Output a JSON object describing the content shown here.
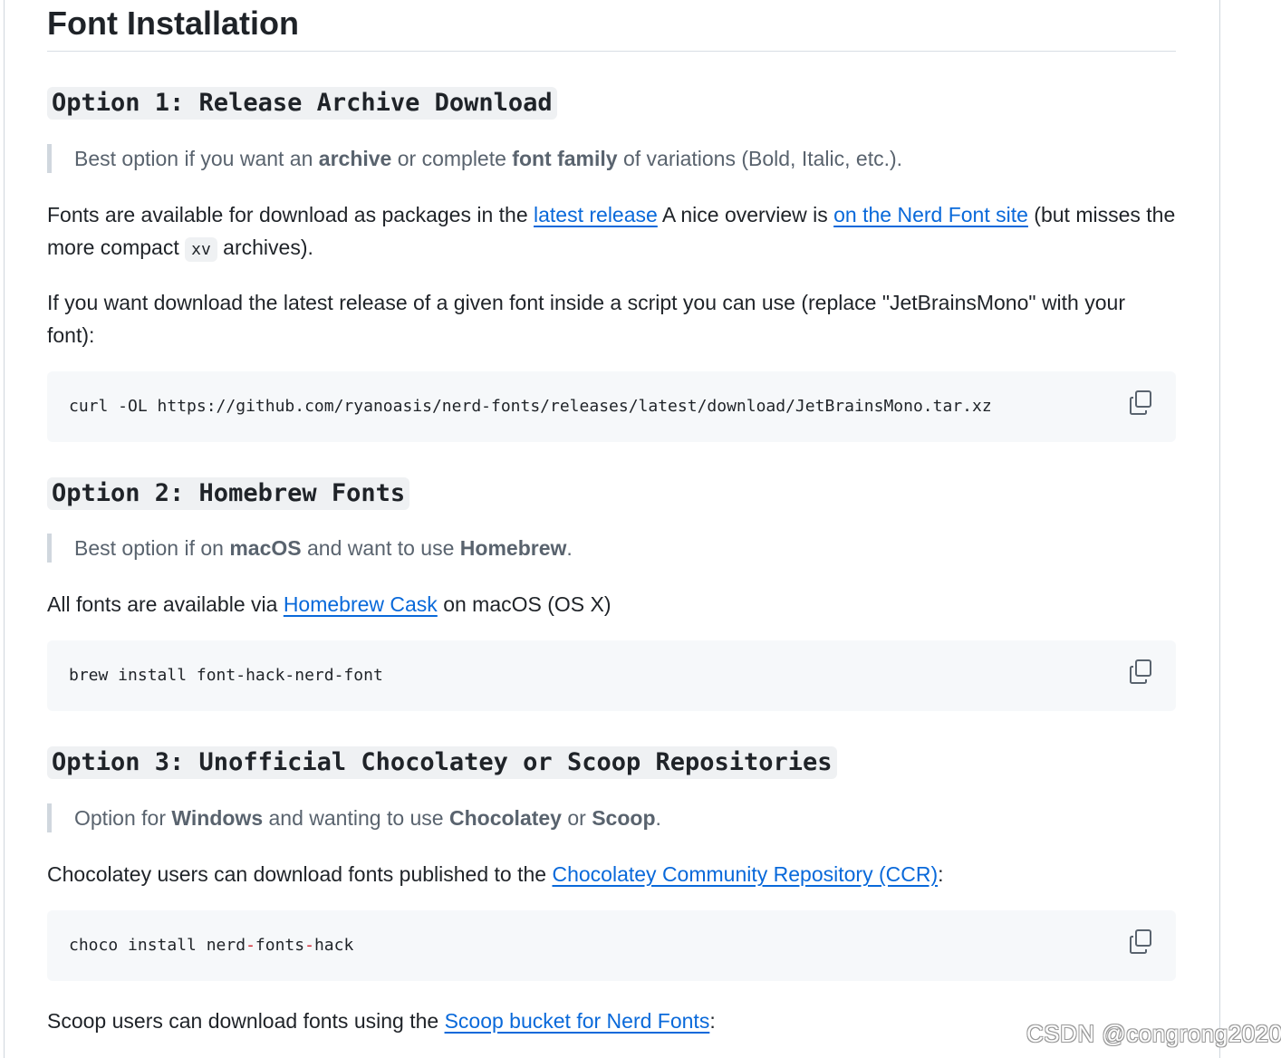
{
  "page": {
    "title": "Font Installation"
  },
  "option1": {
    "heading": "Option 1: Release Archive Download",
    "quote": {
      "t1": "Best option if you want an ",
      "b1": "archive",
      "t2": " or complete ",
      "b2": "font family",
      "t3": " of variations (Bold, Italic, etc.)."
    },
    "para1": {
      "t1": "Fonts are available for download as packages in the ",
      "link1": "latest release",
      "t2": " A nice overview is ",
      "link2": "on the Nerd Font site",
      "t3": " (but misses the more compact ",
      "code": "xv",
      "t4": " archives)."
    },
    "para2": "If you want download the latest release of a given font inside a script you can use (replace \"JetBrainsMono\" with your font):",
    "code": "curl -OL https://github.com/ryanoasis/nerd-fonts/releases/latest/download/JetBrainsMono.tar.xz"
  },
  "option2": {
    "heading": "Option 2: Homebrew Fonts",
    "quote": {
      "t1": "Best option if on ",
      "b1": "macOS",
      "t2": " and want to use ",
      "b2": "Homebrew",
      "t3": "."
    },
    "para": {
      "t1": "All fonts are available via ",
      "link": "Homebrew Cask",
      "t2": " on macOS (OS X)"
    },
    "code": "brew install font-hack-nerd-font"
  },
  "option3": {
    "heading": "Option 3: Unofficial Chocolatey or Scoop Repositories",
    "quote": {
      "t1": "Option for ",
      "b1": "Windows",
      "t2": " and wanting to use ",
      "b2": "Chocolatey",
      "t3": " or ",
      "b3": "Scoop",
      "t4": "."
    },
    "para1": {
      "t1": "Chocolatey users can download fonts published to the ",
      "link": "Chocolatey Community Repository (CCR)",
      "t2": ":"
    },
    "code": {
      "w1": "choco install nerd",
      "d1": "-",
      "w2": "fonts",
      "d2": "-",
      "w3": "hack"
    },
    "para2": {
      "t1": "Scoop users can download fonts using the ",
      "link": "Scoop bucket for Nerd Fonts",
      "t2": ":"
    }
  },
  "icons": {
    "copy": "copy-icon"
  },
  "colors": {
    "link": "#0969da",
    "text": "#1f2328",
    "muted": "#59636e",
    "code_bg": "#f6f8fa",
    "heading_bg": "#eff1f3"
  },
  "watermark": "CSDN @congrong2020"
}
